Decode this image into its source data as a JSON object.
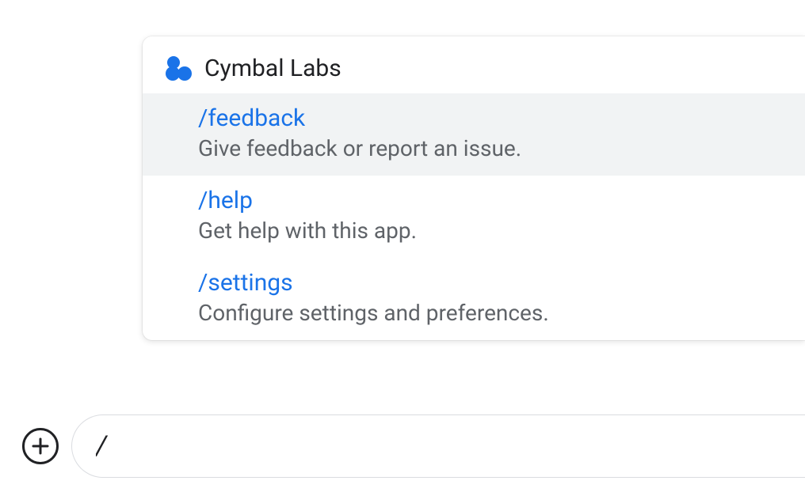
{
  "app": {
    "name": "Cymbal Labs",
    "icon": "cymbal-logo"
  },
  "commands": [
    {
      "name": "/feedback",
      "description": "Give feedback or report an issue.",
      "highlighted": true
    },
    {
      "name": "/help",
      "description": "Get help with this app.",
      "highlighted": false
    },
    {
      "name": "/settings",
      "description": "Configure settings and preferences.",
      "highlighted": false
    }
  ],
  "input": {
    "value": "/",
    "placeholder": ""
  },
  "colors": {
    "command_link": "#1a73e8",
    "text_primary": "#202124",
    "text_secondary": "#5f6368",
    "highlight_bg": "#f1f3f4"
  }
}
